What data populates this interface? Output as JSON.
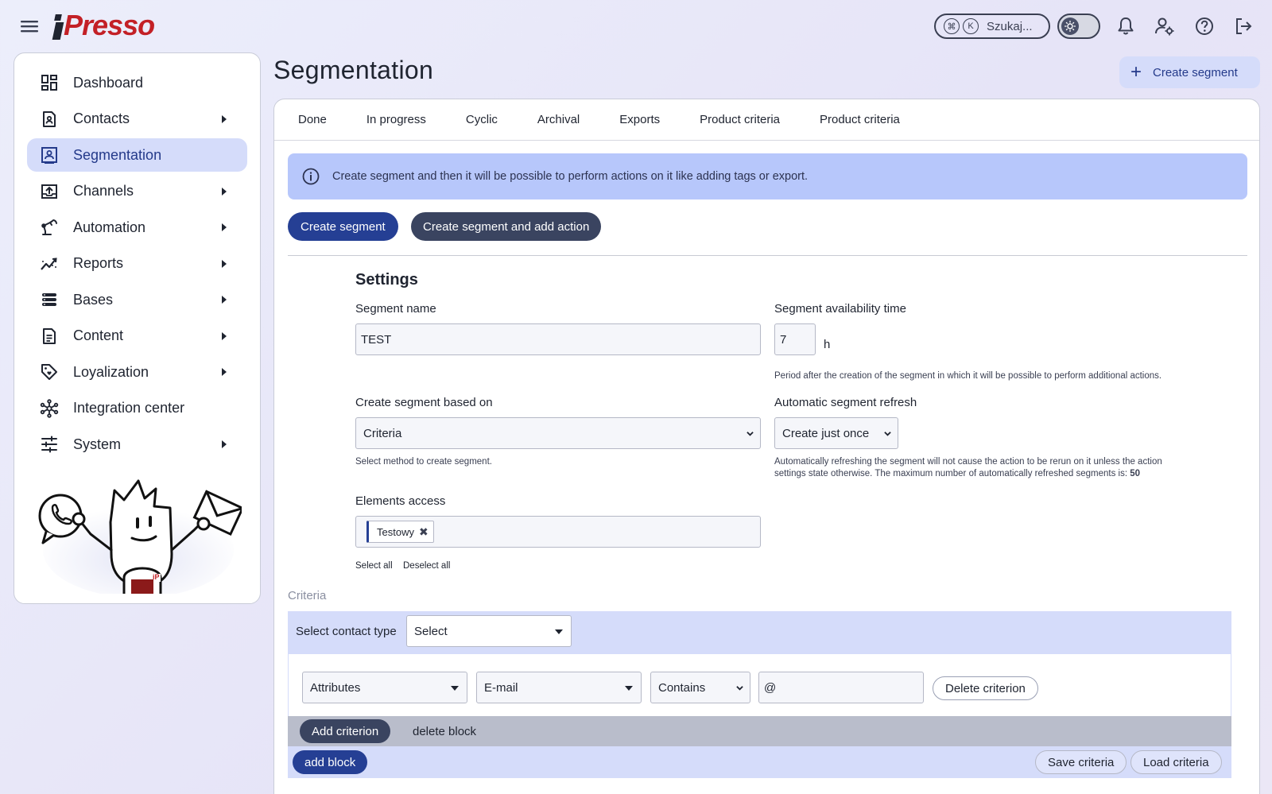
{
  "header": {
    "logo_text": "Presso",
    "search_label": "Szukaj...",
    "search_kbd_1": "⌘",
    "search_kbd_2": "K"
  },
  "sidebar": {
    "items": [
      {
        "label": "Dashboard",
        "icon": "dashboard-icon",
        "has_submenu": false
      },
      {
        "label": "Contacts",
        "icon": "contacts-icon",
        "has_submenu": true
      },
      {
        "label": "Segmentation",
        "icon": "segmentation-icon",
        "has_submenu": false,
        "active": true
      },
      {
        "label": "Channels",
        "icon": "channels-icon",
        "has_submenu": true
      },
      {
        "label": "Automation",
        "icon": "automation-icon",
        "has_submenu": true
      },
      {
        "label": "Reports",
        "icon": "reports-icon",
        "has_submenu": true
      },
      {
        "label": "Bases",
        "icon": "bases-icon",
        "has_submenu": true
      },
      {
        "label": "Content",
        "icon": "content-icon",
        "has_submenu": true
      },
      {
        "label": "Loyalization",
        "icon": "loyalization-icon",
        "has_submenu": true
      },
      {
        "label": "Integration center",
        "icon": "integration-icon",
        "has_submenu": false
      },
      {
        "label": "System",
        "icon": "system-icon",
        "has_submenu": true
      }
    ]
  },
  "main": {
    "title": "Segmentation",
    "create_top_label": "Create segment",
    "tabs": [
      "Done",
      "In progress",
      "Cyclic",
      "Archival",
      "Exports",
      "Product criteria",
      "Product criteria"
    ],
    "info_text": "Create segment and then it will be possible to perform actions on it like adding tags or export.",
    "btn_create": "Create segment",
    "btn_create_action": "Create segment and add action"
  },
  "settings": {
    "title": "Settings",
    "segment_name_label": "Segment name",
    "segment_name_value": "TEST",
    "availability_label": "Segment availability time",
    "availability_value": "7",
    "availability_unit": "h",
    "availability_help": "Period after the creation of the segment in which it will be possible to perform additional actions.",
    "based_on_label": "Create segment based on",
    "based_on_value": "Criteria",
    "based_on_help": "Select method to create segment.",
    "refresh_label": "Automatic segment refresh",
    "refresh_value": "Create just once",
    "refresh_help": "Automatically refreshing the segment will not cause the action to be rerun on it unless the action settings state otherwise. The maximum number of automatically refreshed segments is:",
    "refresh_max": "50",
    "access_label": "Elements access",
    "access_tag": "Testowy",
    "select_all": "Select all",
    "deselect_all": "Deselect all"
  },
  "criteria": {
    "label": "Criteria",
    "contact_type_label": "Select contact type",
    "contact_type_value": "Select",
    "row": {
      "type": "Attributes",
      "attribute": "E-mail",
      "operator": "Contains",
      "value": "@"
    },
    "delete_criterion": "Delete criterion",
    "add_criterion": "Add criterion",
    "delete_block": "delete block",
    "add_block": "add block",
    "save_criteria": "Save criteria",
    "load_criteria": "Load criteria"
  }
}
